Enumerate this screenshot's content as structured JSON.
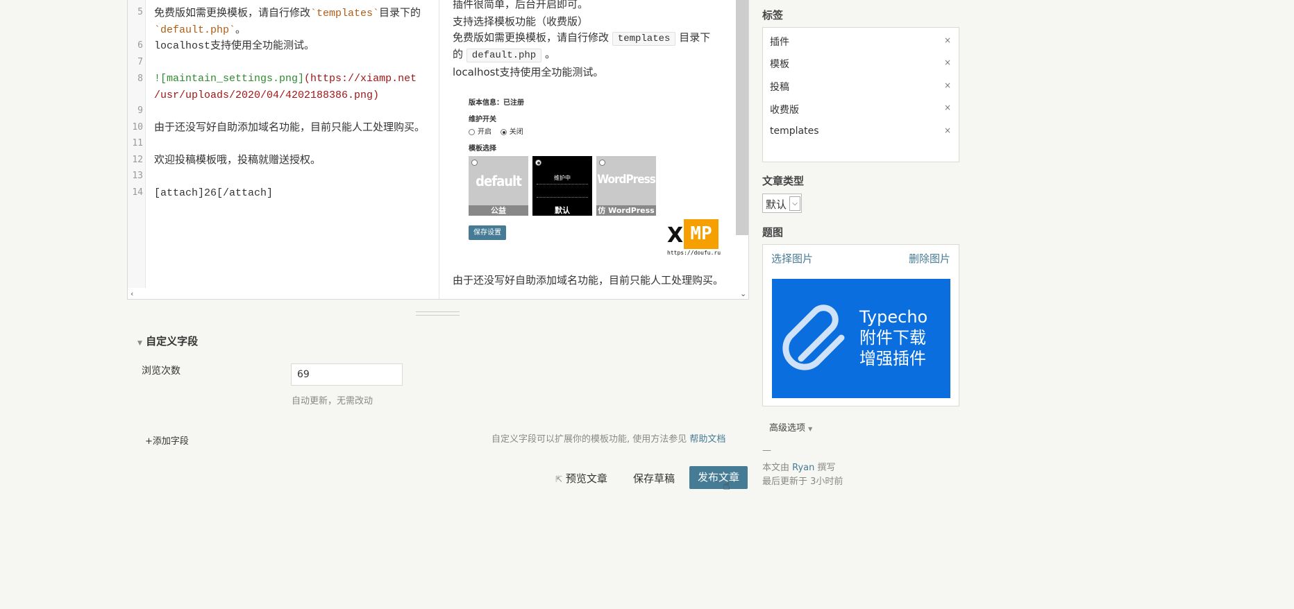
{
  "editor": {
    "lines": [
      {
        "num": "5",
        "prefix": "免费版如需更换模板，请自行修改",
        "code": "`templates`",
        "suffix": "目录下的"
      },
      {
        "num": "",
        "code": "`default.php`",
        "suffix": "。"
      },
      {
        "num": "6",
        "text": "localhost支持使用全功能测试。"
      },
      {
        "num": "7",
        "text": ""
      },
      {
        "num": "8",
        "link": "![maintain_settings.png]",
        "url1": "(https://xiamp.net",
        "url2": "/usr/uploads/2020/04/4202188386.png)"
      },
      {
        "num": "9",
        "text": ""
      },
      {
        "num": "10",
        "text": "由于还没写好自助添加域名功能，目前只能人工处理购买。"
      },
      {
        "num": "11",
        "text": ""
      },
      {
        "num": "12",
        "text": "欢迎投稿模板哦，投稿就赠送授权。"
      },
      {
        "num": "13",
        "text": ""
      },
      {
        "num": "14",
        "text": "[attach]26[/attach]"
      }
    ]
  },
  "preview": {
    "line1": "插件很简单，后台开启即可。",
    "line2": "支持选择模板功能（收费版）",
    "line3_a": "免费版如需更换模板，请自行修改",
    "line3_code": "templates",
    "line3_b": "目录下",
    "line4_a": "的",
    "line4_code": "default.php",
    "line4_b": "。",
    "line5": "localhost支持使用全功能测试。",
    "line6": "由于还没写好自助添加域名功能，目前只能人工处理购买。",
    "shot": {
      "version": "版本信息：已注册",
      "maintain": "维护开关",
      "open": "开启",
      "close": "关闭",
      "template_select": "模板选择",
      "tiles": [
        {
          "name": "default",
          "caption": "公益"
        },
        {
          "name": "维护中",
          "caption": "默认"
        },
        {
          "name": "WordPress",
          "caption": "仿 WordPress"
        }
      ],
      "save": "保存设置",
      "logo_x": "X",
      "logo_mp": "MP",
      "logo_url": "https://doufu.ru"
    }
  },
  "custom_fields": {
    "title": "自定义字段",
    "views_label": "浏览次数",
    "views_value": "69",
    "views_hint": "自动更新，无需改动",
    "add_field": "+添加字段",
    "desc": "自定义字段可以扩展你的模板功能, 使用方法参见",
    "help_link": "帮助文档"
  },
  "actions": {
    "preview": "预览文章",
    "draft": "保存草稿",
    "publish": "发布文章"
  },
  "sidebar": {
    "tags_title": "标签",
    "tags": [
      "插件",
      "模板",
      "投稿",
      "收费版",
      "templates"
    ],
    "type_title": "文章类型",
    "type_value": "默认",
    "image_title": "题图",
    "select_image": "选择图片",
    "delete_image": "删除图片",
    "banner_text": [
      "Typecho",
      "附件下载",
      "增强插件"
    ],
    "advanced": "高级选项",
    "dash": "—",
    "author_prefix": "本文由",
    "author": "Ryan",
    "author_suffix": "撰写",
    "updated": "最后更新于 3小时前"
  },
  "colors": {
    "accent": "#467b96",
    "banner": "#0a6ede"
  }
}
